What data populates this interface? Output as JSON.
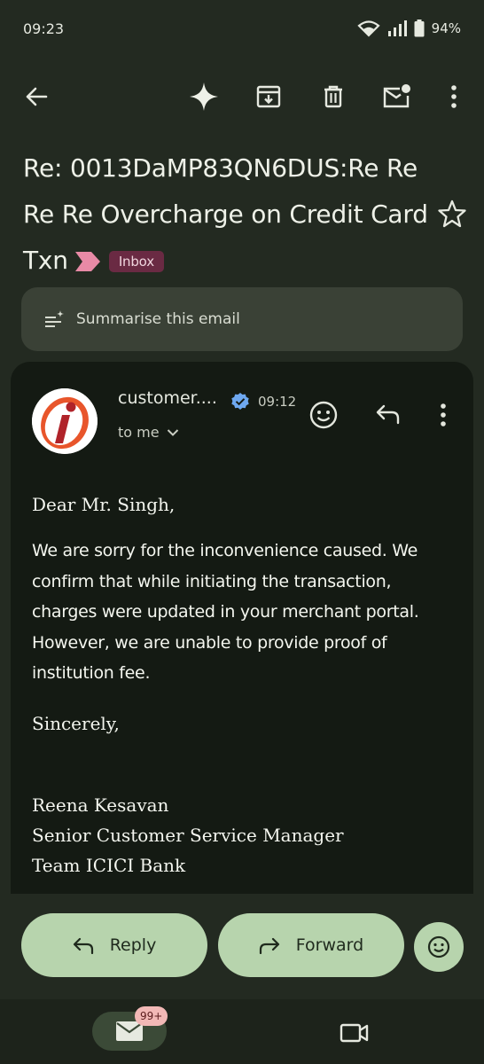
{
  "status_bar": {
    "time": "09:23",
    "battery": "94%"
  },
  "toolbar": {
    "icons": [
      "back-arrow-icon",
      "sparkle-icon",
      "archive-icon",
      "delete-icon",
      "mark-unread-icon",
      "more-vert-icon"
    ]
  },
  "email": {
    "subject": "Re: 0013DaMP83QN6DUS:Re Re Re Re Overcharge on Credit Card Txn",
    "label": "Inbox",
    "summarise_label": "Summarise this email",
    "sender": "customer....",
    "time": "09:12",
    "to": "to me",
    "greeting": "Dear Mr. Singh,",
    "paragraph": "We are sorry for the inconvenience caused. We confirm that while initiating the transaction, charges were updated in your merchant portal. However, we are unable to provide proof of institution fee.",
    "closing": "Sincerely,",
    "signature_name": "Reena Kesavan",
    "signature_title": "Senior Customer Service Manager",
    "signature_team": "Team ICICI Bank"
  },
  "actions": {
    "reply_label": "Reply",
    "forward_label": "Forward"
  },
  "nav": {
    "mail_badge": "99+"
  },
  "colors": {
    "background": "#232a21",
    "card": "#141a13",
    "action_button": "#b7d4ad",
    "inbox_chip": "#6a2a43",
    "label_arrow": "#e88aa6",
    "verified": "#6ea8f0"
  }
}
